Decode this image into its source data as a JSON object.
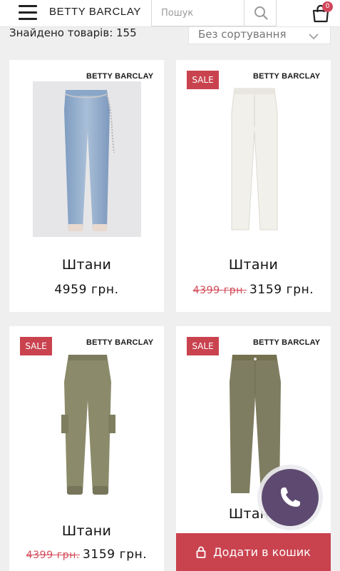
{
  "header": {
    "logo": "BETTY BARCLAY",
    "search_placeholder": "Пошук",
    "cart_count": "0"
  },
  "results": {
    "count_text": "Знайдено товарів: 155",
    "sort_value": "Без сортування"
  },
  "products": [
    {
      "brand": "BETTY BARCLAY",
      "sale": false,
      "title": "Штани",
      "price": "4959 грн.",
      "old_price": ""
    },
    {
      "brand": "BETTY BARCLAY",
      "sale": true,
      "sale_label": "SALE",
      "title": "Штани",
      "price": "3159 грн.",
      "old_price": "4399 грн."
    },
    {
      "brand": "BETTY BARCLAY",
      "sale": true,
      "sale_label": "SALE",
      "title": "Штани",
      "price": "3159 грн.",
      "old_price": "4399 грн."
    },
    {
      "brand": "BETTY BARCLAY",
      "sale": true,
      "sale_label": "SALE",
      "title": "Штани",
      "add_to_cart": "Додати в кошик"
    }
  ],
  "icons": {
    "menu": "hamburger-icon",
    "search": "search-icon",
    "cart": "shopping-bag-icon",
    "call": "phone-icon",
    "lock": "lock-icon",
    "sort": "chevron-down-icon"
  },
  "colors": {
    "accent": "#c9434f",
    "call_button": "#5e4a70",
    "background": "#efefef"
  }
}
